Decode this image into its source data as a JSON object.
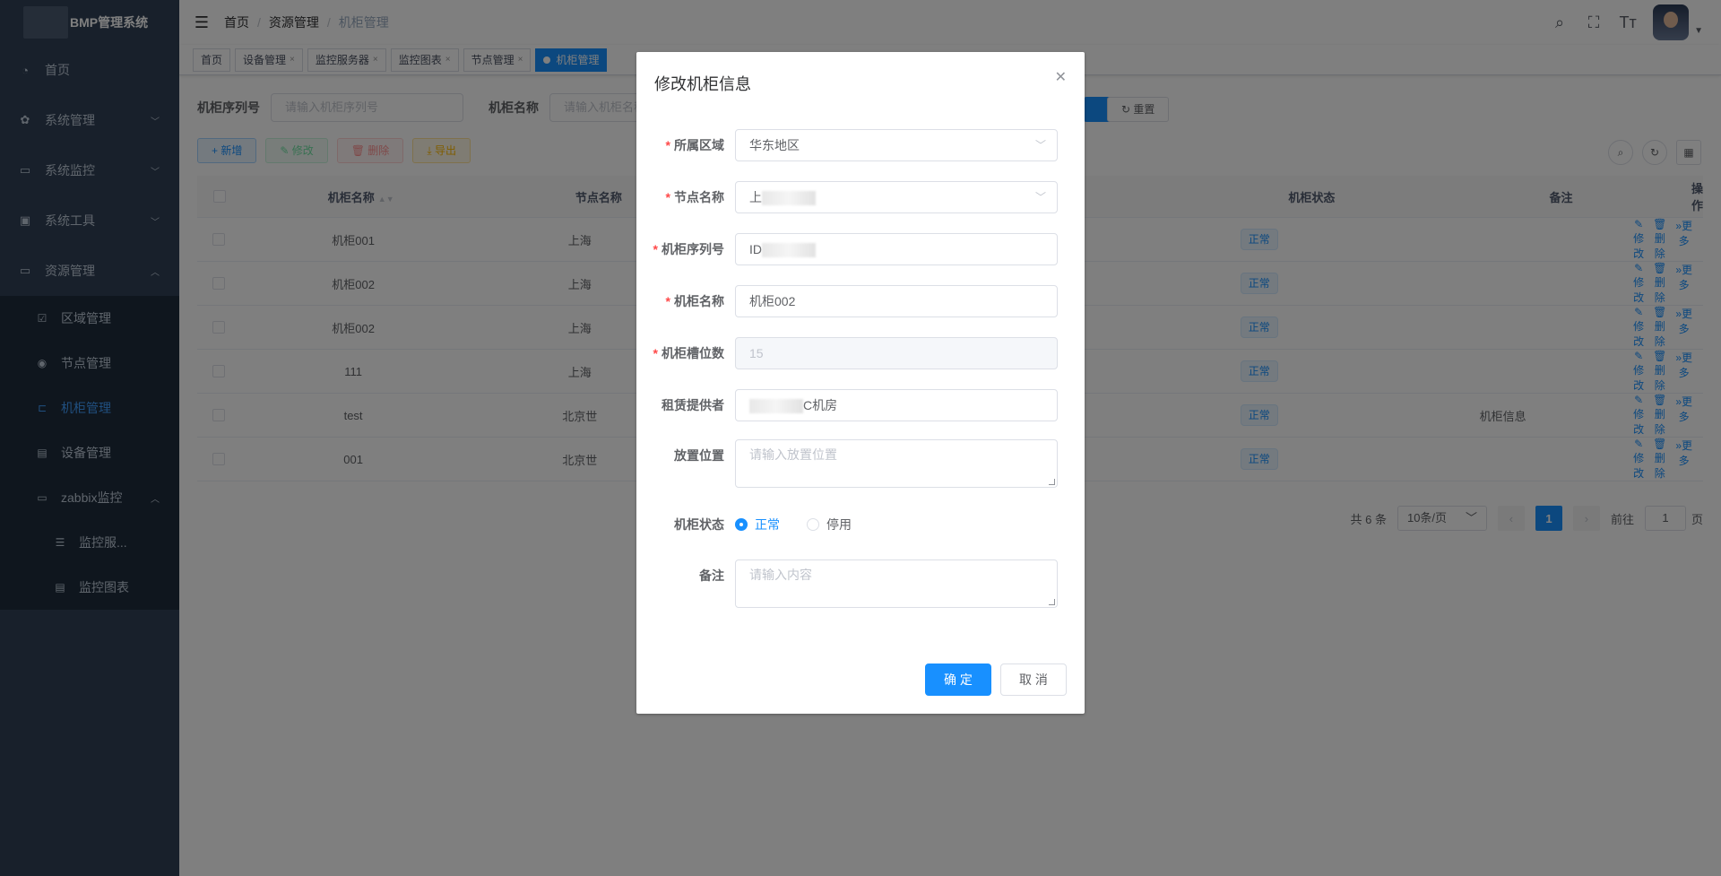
{
  "app": {
    "title": "BMP管理系统"
  },
  "sidebar": {
    "items": [
      {
        "label": "首页",
        "icon": "dashboard-icon",
        "glyph": "◔"
      },
      {
        "label": "系统管理",
        "icon": "gear-icon",
        "glyph": "✿"
      },
      {
        "label": "系统监控",
        "icon": "monitor-icon",
        "glyph": "▭"
      },
      {
        "label": "系统工具",
        "icon": "toolbox-icon",
        "glyph": "▣"
      },
      {
        "label": "资源管理",
        "icon": "screen-icon",
        "glyph": "▭"
      }
    ],
    "resource_sub": [
      {
        "label": "区域管理",
        "glyph": "☑"
      },
      {
        "label": "节点管理",
        "glyph": "◉"
      },
      {
        "label": "机柜管理",
        "glyph": "⊏"
      },
      {
        "label": "设备管理",
        "glyph": "▤"
      },
      {
        "label": "zabbix监控",
        "glyph": "▭"
      }
    ],
    "zabbix_sub": [
      {
        "label": "监控服...",
        "glyph": "☰"
      },
      {
        "label": "监控图表",
        "glyph": "▤"
      }
    ]
  },
  "navbar": {
    "breadcrumb": [
      "首页",
      "资源管理",
      "机柜管理"
    ]
  },
  "tags": [
    "首页",
    "设备管理",
    "监控服务器",
    "监控图表",
    "节点管理",
    "机柜管理"
  ],
  "search": {
    "serial_label": "机柜序列号",
    "serial_placeholder": "请输入机柜序列号",
    "name_label": "机柜名称",
    "name_placeholder": "请输入机柜名称",
    "reset_label": "重置"
  },
  "toolbar": {
    "add": "+ 新增",
    "edit": "✎ 修改",
    "delete": "🗑 删除",
    "export": "⤓ 导出"
  },
  "table": {
    "headers": [
      "机柜名称",
      "节点名称",
      "",
      "",
      "机柜状态",
      "备注",
      "操作"
    ],
    "rows": [
      {
        "name": "机柜001",
        "node": "上海",
        "status": "正常",
        "remark": ""
      },
      {
        "name": "机柜002",
        "node": "上海",
        "status": "正常",
        "remark": ""
      },
      {
        "name": "机柜002",
        "node": "上海",
        "status": "正常",
        "remark": ""
      },
      {
        "name": "111",
        "node": "上海",
        "status": "正常",
        "remark": ""
      },
      {
        "name": "test",
        "node": "北京世",
        "status": "正常",
        "remark": "机柜信息"
      },
      {
        "name": "001",
        "node": "北京世",
        "status": "正常",
        "remark": ""
      }
    ],
    "ops": {
      "edit": "✎修改",
      "delete": "🗑删除",
      "more": "»更多"
    }
  },
  "pagination": {
    "total": "共 6 条",
    "page_size": "10条/页",
    "current": "1",
    "goto_label": "前往",
    "goto_value": "1",
    "page_suffix": "页"
  },
  "dialog": {
    "title": "修改机柜信息",
    "fields": {
      "region": {
        "label": "所属区域",
        "value": "华东地区"
      },
      "node": {
        "label": "节点名称",
        "value": "上"
      },
      "serial": {
        "label": "机柜序列号",
        "value": "ID"
      },
      "name": {
        "label": "机柜名称",
        "value": "机柜002"
      },
      "slots": {
        "label": "机柜槽位数",
        "value": "15"
      },
      "provider": {
        "label": "租赁提供者",
        "value": "C机房"
      },
      "location": {
        "label": "放置位置",
        "placeholder": "请输入放置位置"
      },
      "status": {
        "label": "机柜状态",
        "options": [
          "正常",
          "停用"
        ],
        "selected": "正常"
      },
      "remark": {
        "label": "备注",
        "placeholder": "请输入内容"
      }
    },
    "ok": "确 定",
    "cancel": "取 消"
  }
}
